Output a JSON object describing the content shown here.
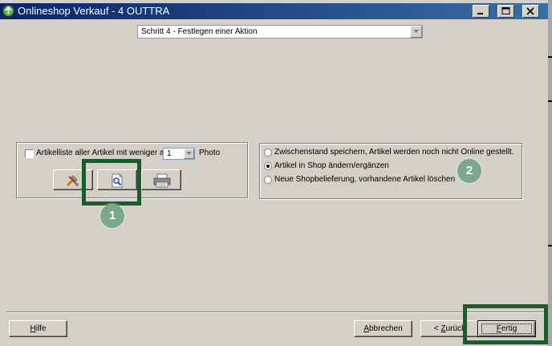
{
  "window": {
    "title": "Onlineshop Verkauf - 4 OUTTRA",
    "controls": [
      "minimize-icon",
      "maximize-icon",
      "close-icon"
    ],
    "titlebar_colors": [
      "#0a246a",
      "#3a6ea5"
    ]
  },
  "step_select": {
    "value": "Schritt 4 - Festlegen einer Aktion"
  },
  "left_panel": {
    "checkbox_label": "Artikelliste aller Artikel mit weniger als",
    "checkbox_checked": false,
    "count_value": "1",
    "count_suffix": "Photo",
    "icon_buttons": [
      "tools-icon",
      "search-document-icon",
      "printer-icon"
    ]
  },
  "right_panel": {
    "options": [
      {
        "label": "Zwischenstand speichern, Artikel werden noch nicht Online gestellt.",
        "selected": false
      },
      {
        "label": "Artikel in Shop ändern/ergänzen",
        "selected": true
      },
      {
        "label": "Neue Shopbelieferung, vorhandene Artikel löschen",
        "selected": false
      }
    ]
  },
  "annotations": {
    "badge_1": "1",
    "badge_2": "2",
    "highlight_color": "#1a5c2c",
    "badge_color": "#7aa88a"
  },
  "footer": {
    "help": {
      "underlined": "H",
      "rest": "ilfe"
    },
    "cancel": {
      "underlined": "A",
      "rest": "bbrechen"
    },
    "back": {
      "prefix": "< ",
      "underlined": "Z",
      "rest": "urück"
    },
    "finish": {
      "underlined": "F",
      "rest": "ertig"
    }
  }
}
